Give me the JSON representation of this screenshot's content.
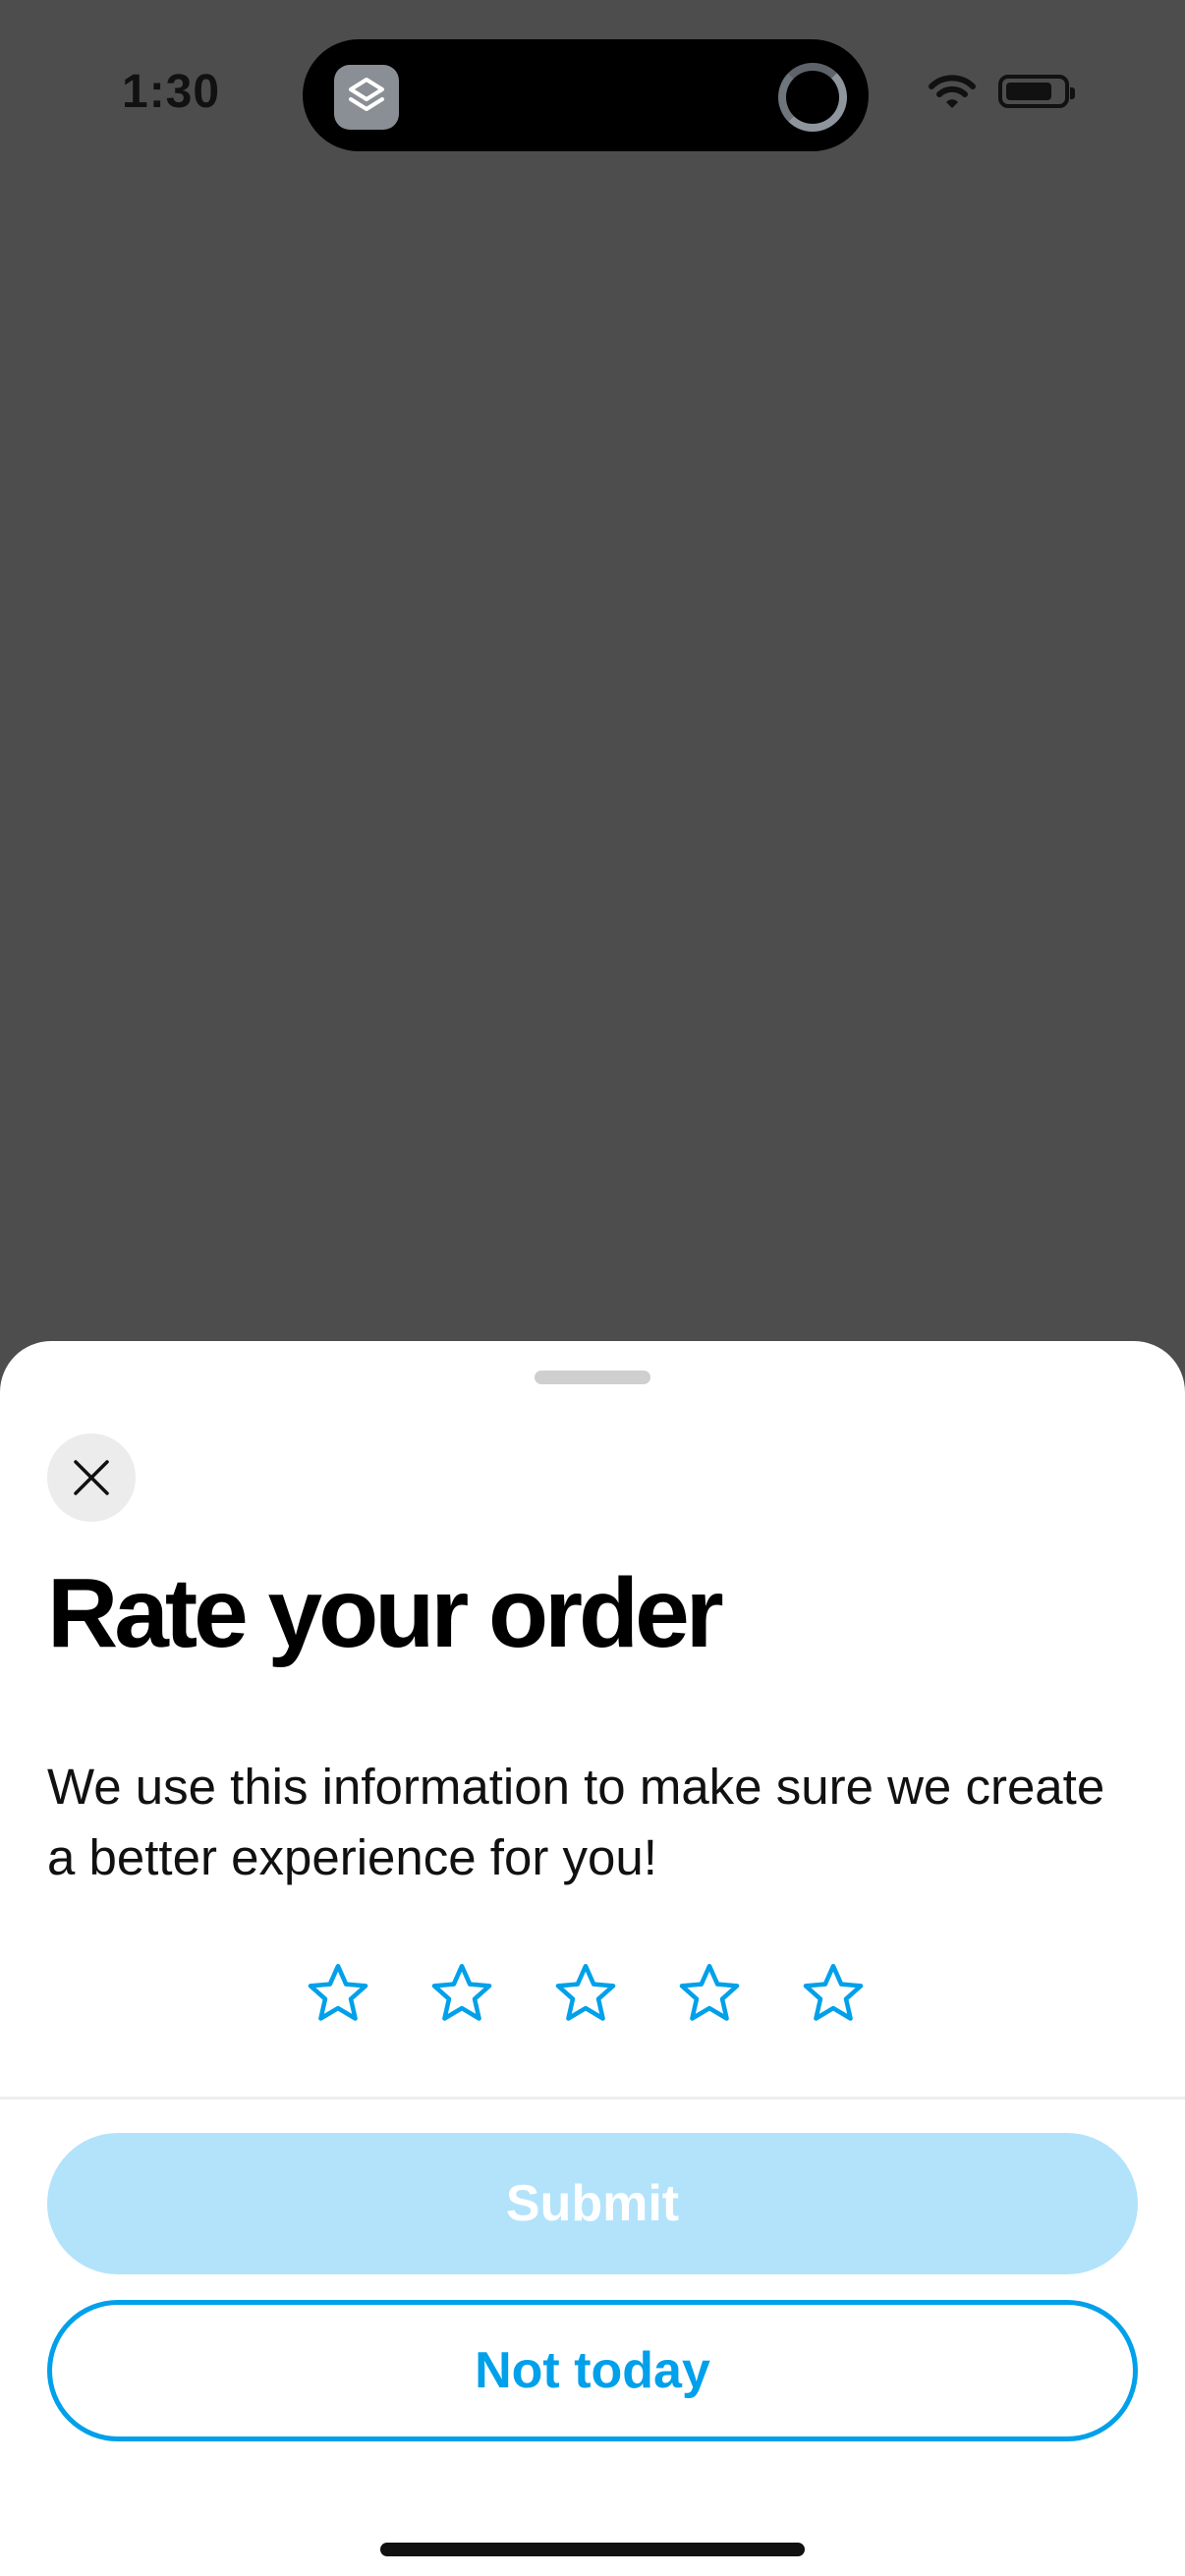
{
  "status_bar": {
    "time": "1:30",
    "icons": [
      "app-stack-icon",
      "loading-ring-icon",
      "wifi-icon",
      "battery-icon"
    ]
  },
  "rating_sheet": {
    "title": "Rate your order",
    "description": "We use this information to make sure we create a better experience for you!",
    "stars_total": 5,
    "stars_selected": 0,
    "submit_label": "Submit",
    "not_today_label": "Not today",
    "close_icon": "close-icon"
  },
  "colors": {
    "accent": "#00a0ea",
    "submit_disabled_bg": "#b2e3fb",
    "dim_overlay": "#4d4d4d",
    "close_button_bg": "#ececec"
  }
}
